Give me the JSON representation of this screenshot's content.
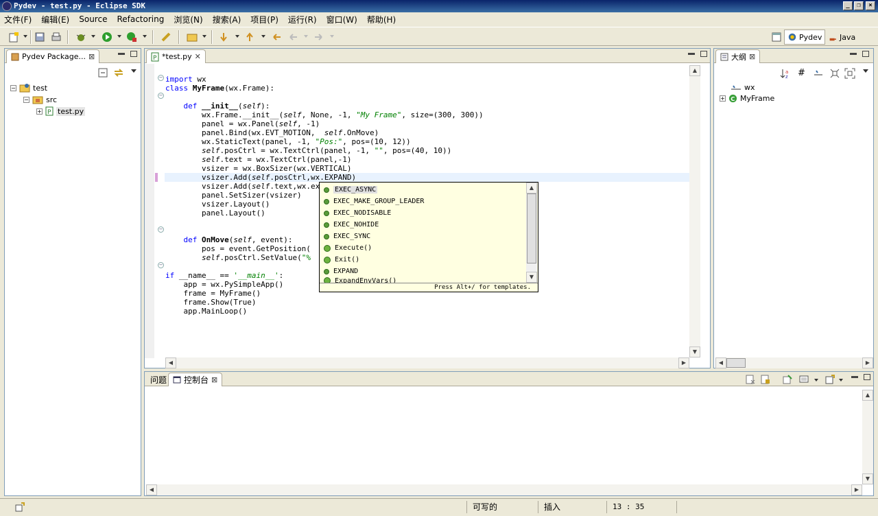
{
  "window": {
    "title": "Pydev - test.py - Eclipse SDK"
  },
  "menu": [
    "文件(F)",
    "编辑(E)",
    "Source",
    "Refactoring",
    "浏览(N)",
    "搜索(A)",
    "项目(P)",
    "运行(R)",
    "窗口(W)",
    "帮助(H)"
  ],
  "perspectives": {
    "pydev": "Pydev",
    "java": "Java"
  },
  "package_explorer": {
    "title": "Pydev Package...",
    "tree": {
      "project": "test",
      "folder": "src",
      "file": "test.py"
    }
  },
  "editor": {
    "tab": "*test.py",
    "lines": [
      "import wx",
      "class MyFrame(wx.Frame):",
      "",
      "    def __init__(self):",
      "        wx.Frame.__init__(self, None, -1, \"My Frame\", size=(300, 300))",
      "        panel = wx.Panel(self, -1)",
      "        panel.Bind(wx.EVT_MOTION,  self.OnMove)",
      "        wx.StaticText(panel, -1, \"Pos:\", pos=(10, 12))",
      "        self.posCtrl = wx.TextCtrl(panel, -1, \"\", pos=(40, 10))",
      "        self.text = wx.TextCtrl(panel,-1)",
      "        vsizer = wx.BoxSizer(wx.VERTICAL)",
      "        vsizer.Add(self.posCtrl,wx.EXPAND)",
      "        vsizer.Add(self.text,wx.ex",
      "        panel.SetSizer(vsizer)",
      "        vsizer.Layout()",
      "        panel.Layout()",
      "",
      "",
      "    def OnMove(self, event):",
      "        pos = event.GetPosition(",
      "        self.posCtrl.SetValue(\"%",
      "",
      "if __name__ == '__main__':",
      "    app = wx.PySimpleApp()",
      "    frame = MyFrame()",
      "    frame.Show(True)",
      "    app.MainLoop()"
    ]
  },
  "completion": {
    "items": [
      "EXEC_ASYNC",
      "EXEC_MAKE_GROUP_LEADER",
      "EXEC_NODISABLE",
      "EXEC_NOHIDE",
      "EXEC_SYNC",
      "Execute()",
      "Exit()",
      "EXPAND",
      "ExpandEnvVars()"
    ],
    "footer": "Press Alt+/ for templates."
  },
  "outline": {
    "title": "大纲",
    "items": [
      "wx",
      "MyFrame"
    ]
  },
  "bottom": {
    "tab_problems": "问题",
    "tab_console": "控制台"
  },
  "status": {
    "writable": "可写的",
    "insert": "插入",
    "position": "13 : 35"
  }
}
